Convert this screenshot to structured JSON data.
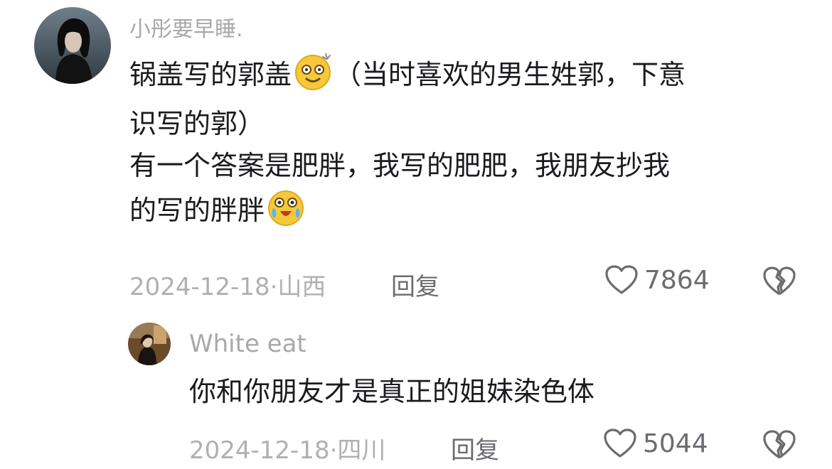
{
  "comment": {
    "username": "小彤要早睡.",
    "text_line1_before": "锅盖写的郭盖",
    "text_line1_after": "（当时喜欢的男生姓郭，下意",
    "text_line2": "识写的郭）",
    "text_line3": "有一个答案是肥胖，我写的肥肥，我朋友抄我",
    "text_line4": "的写的胖胖",
    "emoji1": "dizzy-smile-emoji",
    "emoji2": "laugh-cry-emoji",
    "date": "2024-12-18",
    "location": "山西",
    "date_separator": "·",
    "reply_label": "回复",
    "likes": "7864"
  },
  "reply": {
    "username": "White eat",
    "text": "你和你朋友才是真正的姐妹染色体",
    "date": "2024-12-18",
    "location": "四川",
    "date_separator": "·",
    "reply_label": "回复",
    "likes": "5044"
  },
  "colors": {
    "meta": "#b0b0b4",
    "username": "#a8a8ac",
    "text": "#1b1b1f",
    "icon": "#6b6b70"
  }
}
